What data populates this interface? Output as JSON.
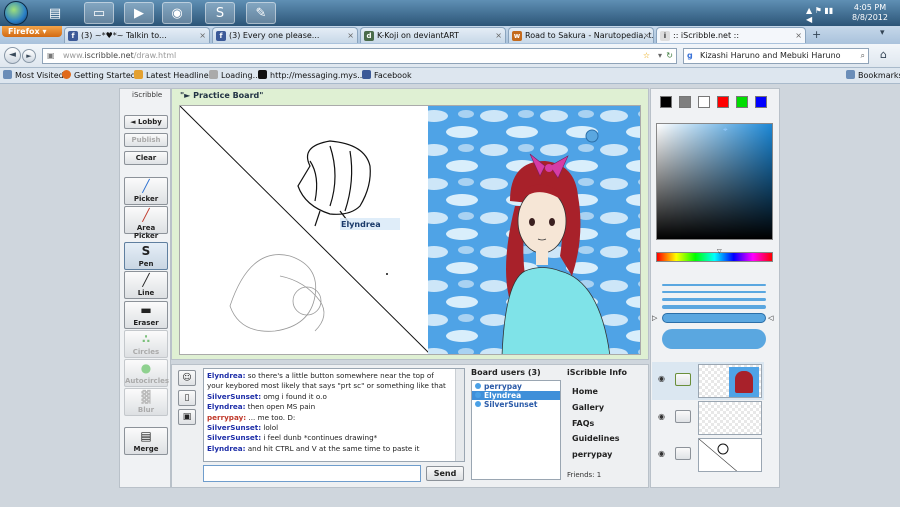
{
  "taskbar": {
    "clock_time": "4:05 PM",
    "clock_date": "8/8/2012",
    "apps": [
      "explorer-icon",
      "notepad-icon",
      "folder-icon",
      "media-icon",
      "firefox-icon",
      "skype-icon",
      "paint-icon"
    ]
  },
  "browser": {
    "menu_label": "Firefox",
    "tabs": [
      {
        "label": "(3) ~*♥*~ Talkin to..."
      },
      {
        "label": "(3) Every one please..."
      },
      {
        "label": "K-Koji on deviantART"
      },
      {
        "label": "Road to Sakura - Narutopedia, t..."
      },
      {
        "label": ":: iScribble.net ::"
      }
    ],
    "url_host": "www.",
    "url_domain": "iscribble.net",
    "url_path": "/draw.html",
    "search_value": "Kizashi Haruno and Mebuki Haruno",
    "bookmarks": [
      "Most Visited",
      "Getting Started",
      "Latest Headlines",
      "Loading...",
      "http://messaging.mys...",
      "Facebook"
    ],
    "bookmarks_right": "Bookmarks"
  },
  "app": {
    "brand": "iScribble",
    "board_title": "\"► Practice Board\"",
    "left_buttons": {
      "lobby": "◄ Lobby",
      "publish": "Publish",
      "clear": "Clear"
    },
    "tools": [
      {
        "label": "Picker"
      },
      {
        "label": "Area Picker"
      },
      {
        "label": "Pen"
      },
      {
        "label": "Line"
      },
      {
        "label": "Eraser"
      },
      {
        "label": "Circles"
      },
      {
        "label": "Autocircles"
      },
      {
        "label": "Blur"
      },
      {
        "label": "Merge"
      }
    ],
    "cursor_label": "Elyndrea",
    "chat": [
      {
        "user": "Elyndrea:",
        "text": " so there's a little button somewhere near the top of your keybored most likely that says \"prt sc\" or something like that"
      },
      {
        "user": "SilverSunset:",
        "text": " omg i found it o.o"
      },
      {
        "user": "Elyndrea:",
        "text": " then open MS pain"
      },
      {
        "user": "perrypay:",
        "text": " ... me too. D:"
      },
      {
        "user": "SilverSunset:",
        "text": " lolol"
      },
      {
        "user": "SilverSunset:",
        "text": " i feel dunb *continues drawing*"
      },
      {
        "user": "Elyndrea:",
        "text": " and hit CTRL and V at the same time to paste it"
      }
    ],
    "send_label": "Send",
    "board_users_title": "Board users (3)",
    "board_users": [
      "perrypay",
      "Elyndrea",
      "SilverSunset"
    ],
    "info_title": "iScribble Info",
    "info_links": [
      "Home",
      "Gallery",
      "FAQs",
      "Guidelines",
      "perrypay"
    ],
    "friends": "Friends: 1",
    "swatches": [
      "#000000",
      "#7f7f7f",
      "#ffffff",
      "#ff0000",
      "#00dd00",
      "#0000ff"
    ]
  }
}
